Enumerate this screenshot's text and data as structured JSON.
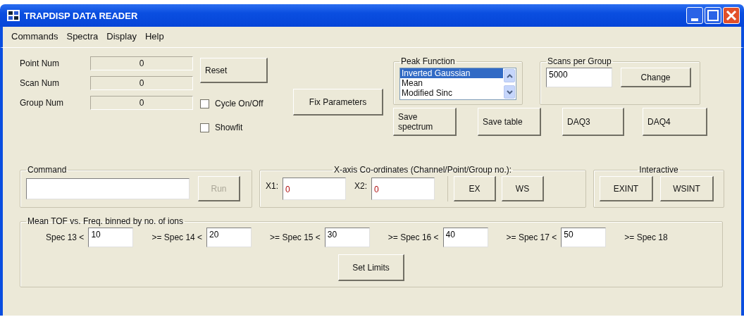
{
  "window": {
    "title": "TRAPDISP DATA READER"
  },
  "menu": [
    "Commands",
    "Spectra",
    "Display",
    "Help"
  ],
  "counters": [
    {
      "label": "Point Num",
      "value": "0"
    },
    {
      "label": "Scan Num",
      "value": "0"
    },
    {
      "label": "Group Num",
      "value": "0"
    }
  ],
  "reset_button": "Reset",
  "checkboxes": [
    {
      "label": "Cycle On/Off",
      "checked": false
    },
    {
      "label": "Showfit",
      "checked": false
    }
  ],
  "fix_button": "Fix Parameters",
  "peak_function": {
    "title": "Peak Function",
    "items": [
      {
        "label": "Inverted Gaussian",
        "selected": true
      },
      {
        "label": "Mean",
        "selected": false
      },
      {
        "label": "Modified Sinc",
        "selected": false
      }
    ]
  },
  "scans_per_group": {
    "title": "Scans per Group",
    "value": "5000",
    "button": "Change"
  },
  "action_buttons": [
    "Save spectrum",
    "Save table",
    "DAQ3",
    "DAQ4"
  ],
  "command": {
    "title": "Command",
    "button": "Run",
    "button_disabled": true
  },
  "x_axis": {
    "title": "X-axis Co-ordinates (Channel/Point/Group no.):",
    "fields": [
      {
        "label": "X1:",
        "value": "0"
      },
      {
        "label": "X2:",
        "value": "0"
      }
    ],
    "buttons": [
      "EX",
      "WS"
    ]
  },
  "interactive": {
    "title": "Interactive",
    "buttons": [
      "EXINT",
      "WSINT"
    ]
  },
  "bins": {
    "title": "Mean TOF vs. Freq. binned by no. of ions",
    "entries": [
      {
        "label": "Spec 13 <",
        "value": "10"
      },
      {
        "label": ">= Spec 14 <",
        "value": "20"
      },
      {
        "label": ">= Spec 15 <",
        "value": "30"
      },
      {
        "label": ">= Spec 16 <",
        "value": "40"
      },
      {
        "label": ">= Spec 17 <",
        "value": "50"
      }
    ],
    "last_label": ">= Spec 18",
    "button": "Set Limits"
  }
}
